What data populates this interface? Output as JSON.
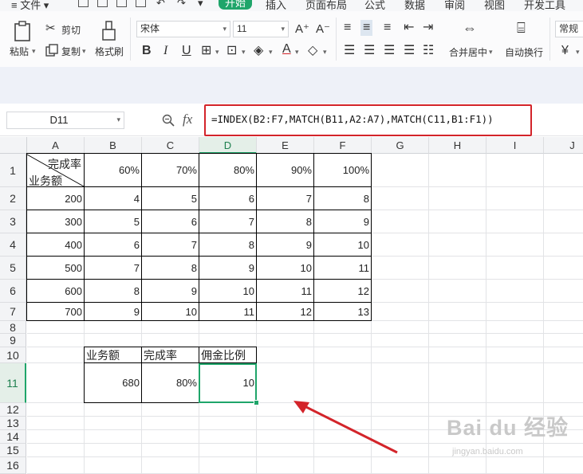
{
  "menu": {
    "file": "≡ 文件 ▾",
    "tabs": [
      "开始",
      "插入",
      "页面布局",
      "公式",
      "数据",
      "审阅",
      "视图",
      "开发工具"
    ],
    "active_tab_index": 0
  },
  "ribbon": {
    "paste": "粘贴",
    "cut": "剪切",
    "copy": "复制",
    "format_painter": "格式刷",
    "font_name": "宋体",
    "font_size": "11",
    "bold": "B",
    "italic": "I",
    "underline": "U",
    "merge_center": "合并居中",
    "wrap_text": "自动换行",
    "number_format": "常规",
    "currency": "¥"
  },
  "formula_bar": {
    "cell_ref": "D11",
    "fx": "fx",
    "formula": "=INDEX(B2:F7,MATCH(B11,A2:A7),MATCH(C11,B1:F1))"
  },
  "grid": {
    "columns": [
      "A",
      "B",
      "C",
      "D",
      "E",
      "F",
      "G",
      "H",
      "I",
      "J"
    ],
    "selected_column": "D",
    "rows": [
      "1",
      "2",
      "3",
      "4",
      "5",
      "6",
      "7",
      "8",
      "9",
      "10",
      "11",
      "12",
      "13",
      "14",
      "15",
      "16"
    ],
    "selected_row": "11",
    "header_top_right": "完成率",
    "header_bottom_left": "业务额",
    "rates": [
      "60%",
      "70%",
      "80%",
      "90%",
      "100%"
    ],
    "table": [
      {
        "amount": "200",
        "values": [
          "4",
          "5",
          "6",
          "7",
          "8"
        ]
      },
      {
        "amount": "300",
        "values": [
          "5",
          "6",
          "7",
          "8",
          "9"
        ]
      },
      {
        "amount": "400",
        "values": [
          "6",
          "7",
          "8",
          "9",
          "10"
        ]
      },
      {
        "amount": "500",
        "values": [
          "7",
          "8",
          "9",
          "10",
          "11"
        ]
      },
      {
        "amount": "600",
        "values": [
          "8",
          "9",
          "10",
          "11",
          "12"
        ]
      },
      {
        "amount": "700",
        "values": [
          "9",
          "10",
          "11",
          "12",
          "13"
        ]
      }
    ],
    "lookup_headers": [
      "业务额",
      "完成率",
      "佣金比例"
    ],
    "lookup_values": [
      "680",
      "80%",
      "10"
    ]
  },
  "watermark": {
    "text": "Bai du 经验",
    "url": "jingyan.baidu.com"
  },
  "colors": {
    "accent": "#1fa56a",
    "highlight_border": "#d3242a",
    "arrow": "#d3242a"
  }
}
